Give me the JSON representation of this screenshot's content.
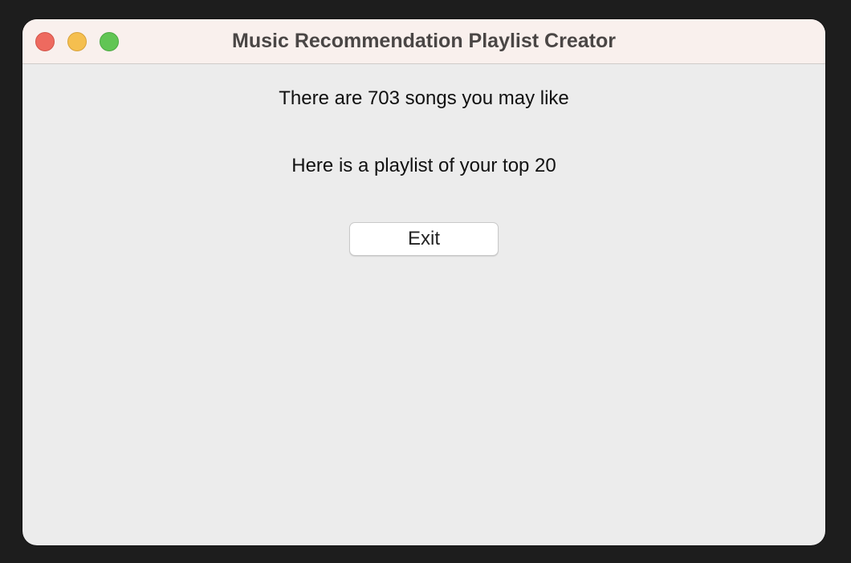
{
  "window": {
    "title": "Music Recommendation Playlist Creator",
    "controls": {
      "close_icon": "close-icon",
      "minimize_icon": "minimize-icon",
      "zoom_icon": "zoom-icon",
      "colors": {
        "close": "#ee6a5f",
        "minimize": "#f5bf4f",
        "zoom": "#61c554"
      }
    }
  },
  "main": {
    "songs_message": "There are 703 songs you may like",
    "playlist_message": "Here is a playlist of your top 20",
    "exit_label": "Exit"
  }
}
